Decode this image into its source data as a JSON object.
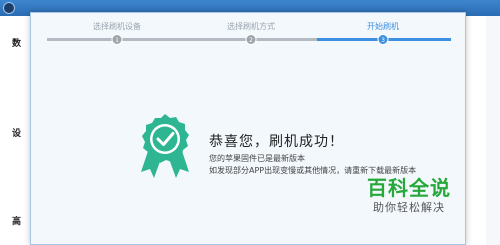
{
  "background_app": {
    "title": "",
    "side_labels": [
      "数",
      "设",
      "高"
    ]
  },
  "steps": [
    {
      "label": "选择刷机设备",
      "number": "1",
      "state": "done"
    },
    {
      "label": "选择刷机方式",
      "number": "2",
      "state": "done"
    },
    {
      "label": "开始刷机",
      "number": "3",
      "state": "active"
    }
  ],
  "result": {
    "title": "恭喜您，刷机成功！",
    "line1": "您的苹果固件已是最新版本",
    "line2": "如发现部分APP出现变慢或其他情况，请重新下载最新版本"
  },
  "watermark": {
    "main": "百科全说",
    "sub": "助你轻松解决"
  },
  "colors": {
    "accent": "#3d8fe0",
    "success": "#2eb591",
    "watermark": "#27a83a"
  }
}
